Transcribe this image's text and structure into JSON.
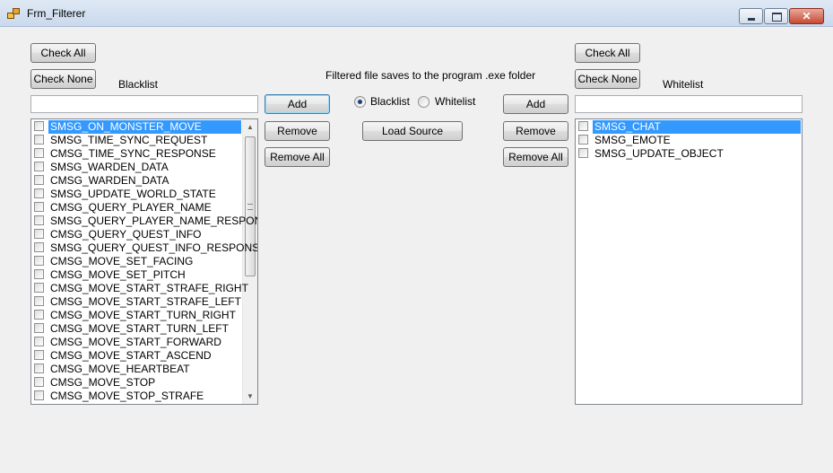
{
  "window": {
    "title": "Frm_Filterer"
  },
  "left": {
    "check_all": "Check All",
    "check_none": "Check None",
    "label": "Blacklist",
    "add": "Add",
    "remove": "Remove",
    "remove_all": "Remove All",
    "selected_index": 0,
    "items": [
      "SMSG_ON_MONSTER_MOVE",
      "SMSG_TIME_SYNC_REQUEST",
      "CMSG_TIME_SYNC_RESPONSE",
      "SMSG_WARDEN_DATA",
      "CMSG_WARDEN_DATA",
      "SMSG_UPDATE_WORLD_STATE",
      "CMSG_QUERY_PLAYER_NAME",
      "SMSG_QUERY_PLAYER_NAME_RESPONSE",
      "CMSG_QUERY_QUEST_INFO",
      "SMSG_QUERY_QUEST_INFO_RESPONSE",
      "CMSG_MOVE_SET_FACING",
      "CMSG_MOVE_SET_PITCH",
      "CMSG_MOVE_START_STRAFE_RIGHT",
      "CMSG_MOVE_START_STRAFE_LEFT",
      "CMSG_MOVE_START_TURN_RIGHT",
      "CMSG_MOVE_START_TURN_LEFT",
      "CMSG_MOVE_START_FORWARD",
      "CMSG_MOVE_START_ASCEND",
      "CMSG_MOVE_HEARTBEAT",
      "CMSG_MOVE_STOP",
      "CMSG_MOVE_STOP_STRAFE"
    ]
  },
  "middle": {
    "info": "Filtered file saves to the program .exe folder",
    "radio_blacklist": "Blacklist",
    "radio_whitelist": "Whitelist",
    "selected_mode": "Blacklist",
    "load_source": "Load Source"
  },
  "right": {
    "check_all": "Check All",
    "check_none": "Check None",
    "label": "Whitelist",
    "add": "Add",
    "remove": "Remove",
    "remove_all": "Remove All",
    "selected_index": 0,
    "items": [
      "SMSG_CHAT",
      "SMSG_EMOTE",
      "SMSG_UPDATE_OBJECT"
    ]
  }
}
